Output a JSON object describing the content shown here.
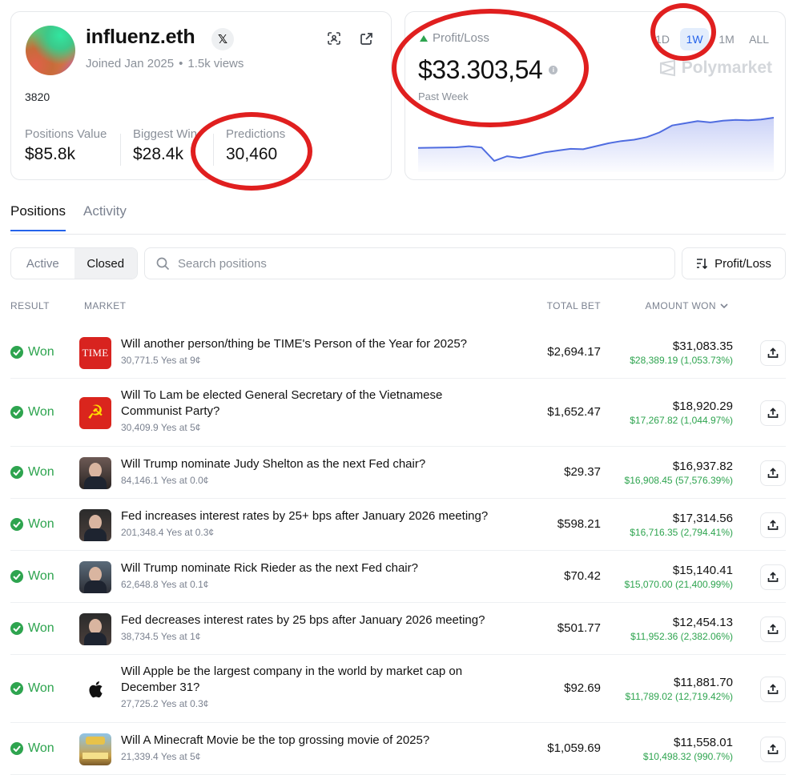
{
  "profile": {
    "username": "influenz.eth",
    "x_label": "𝕏",
    "joined": "Joined Jan 2025",
    "separator": "•",
    "views": "1.5k views",
    "bio": "3820",
    "stats": [
      {
        "label": "Positions Value",
        "value": "$85.8k"
      },
      {
        "label": "Biggest Win",
        "value": "$28.4k"
      },
      {
        "label": "Predictions",
        "value": "30,460"
      }
    ]
  },
  "pnl": {
    "label": "Profit/Loss",
    "value": "$33.303,54",
    "info": "i",
    "period": "Past Week",
    "ranges": [
      "1D",
      "1W",
      "1M",
      "ALL"
    ],
    "active_range": "1W",
    "brand": "Polymarket",
    "colors": {
      "line": "#4f6ce0",
      "up": "#2ea44f"
    },
    "series": [
      -0.6,
      -0.55,
      -0.5,
      -0.45,
      -0.2,
      -0.5,
      -3.6,
      -2.5,
      -2.9,
      -2.3,
      -1.6,
      -1.2,
      -0.8,
      -0.9,
      -0.2,
      0.5,
      1.0,
      1.3,
      1.9,
      3.0,
      4.6,
      5.1,
      5.6,
      5.3,
      5.7,
      5.9,
      5.8,
      6.0,
      6.4
    ]
  },
  "tabs": {
    "positions": "Positions",
    "activity": "Activity"
  },
  "filters": {
    "active": "Active",
    "closed": "Closed",
    "search_placeholder": "Search positions",
    "sort_label": "Profit/Loss"
  },
  "table": {
    "headers": {
      "result": "RESULT",
      "market": "MARKET",
      "total_bet": "TOTAL BET",
      "amount_won": "AMOUNT WON"
    },
    "rows": [
      {
        "result": "Won",
        "title": "Will another person/thing be TIME's Person of the Year for 2025?",
        "sub": "30,771.5 Yes at 9¢",
        "bet": "$2,694.17",
        "won": "$31,083.35",
        "gain": "$28,389.19 (1,053.73%)",
        "thumb": "time",
        "thumb_text": "TIME"
      },
      {
        "result": "Won",
        "title": "Will To Lam be elected General Secretary of the Vietnamese Communist Party?",
        "sub": "30,409.9 Yes at 5¢",
        "bet": "$1,652.47",
        "won": "$18,920.29",
        "gain": "$17,267.82 (1,044.97%)",
        "thumb": "flag",
        "thumb_text": "☭"
      },
      {
        "result": "Won",
        "title": "Will Trump nominate Judy Shelton as the next Fed chair?",
        "sub": "84,146.1 Yes at 0.0¢",
        "bet": "$29.37",
        "won": "$16,937.82",
        "gain": "$16,908.45 (57,576.39%)",
        "thumb": "p1",
        "thumb_text": ""
      },
      {
        "result": "Won",
        "title": "Fed increases interest rates by 25+ bps after January 2026 meeting?",
        "sub": "201,348.4 Yes at 0.3¢",
        "bet": "$598.21",
        "won": "$17,314.56",
        "gain": "$16,716.35 (2,794.41%)",
        "thumb": "p2",
        "thumb_text": ""
      },
      {
        "result": "Won",
        "title": "Will Trump nominate Rick Rieder as the next Fed chair?",
        "sub": "62,648.8 Yes at 0.1¢",
        "bet": "$70.42",
        "won": "$15,140.41",
        "gain": "$15,070.00 (21,400.99%)",
        "thumb": "p3",
        "thumb_text": ""
      },
      {
        "result": "Won",
        "title": "Fed decreases interest rates by 25 bps after January 2026 meeting?",
        "sub": "38,734.5 Yes at 1¢",
        "bet": "$501.77",
        "won": "$12,454.13",
        "gain": "$11,952.36 (2,382.06%)",
        "thumb": "p2",
        "thumb_text": ""
      },
      {
        "result": "Won",
        "title": "Will Apple be the largest company in the world by market cap on December 31?",
        "sub": "27,725.2 Yes at 0.3¢",
        "bet": "$92.69",
        "won": "$11,881.70",
        "gain": "$11,789.02 (12,719.42%)",
        "thumb": "apple",
        "thumb_text": ""
      },
      {
        "result": "Won",
        "title": "Will A Minecraft Movie be the top grossing movie of 2025?",
        "sub": "21,339.4 Yes at 5¢",
        "bet": "$1,059.69",
        "won": "$11,558.01",
        "gain": "$10,498.32 (990.7%)",
        "thumb": "mc",
        "thumb_text": ""
      }
    ]
  }
}
